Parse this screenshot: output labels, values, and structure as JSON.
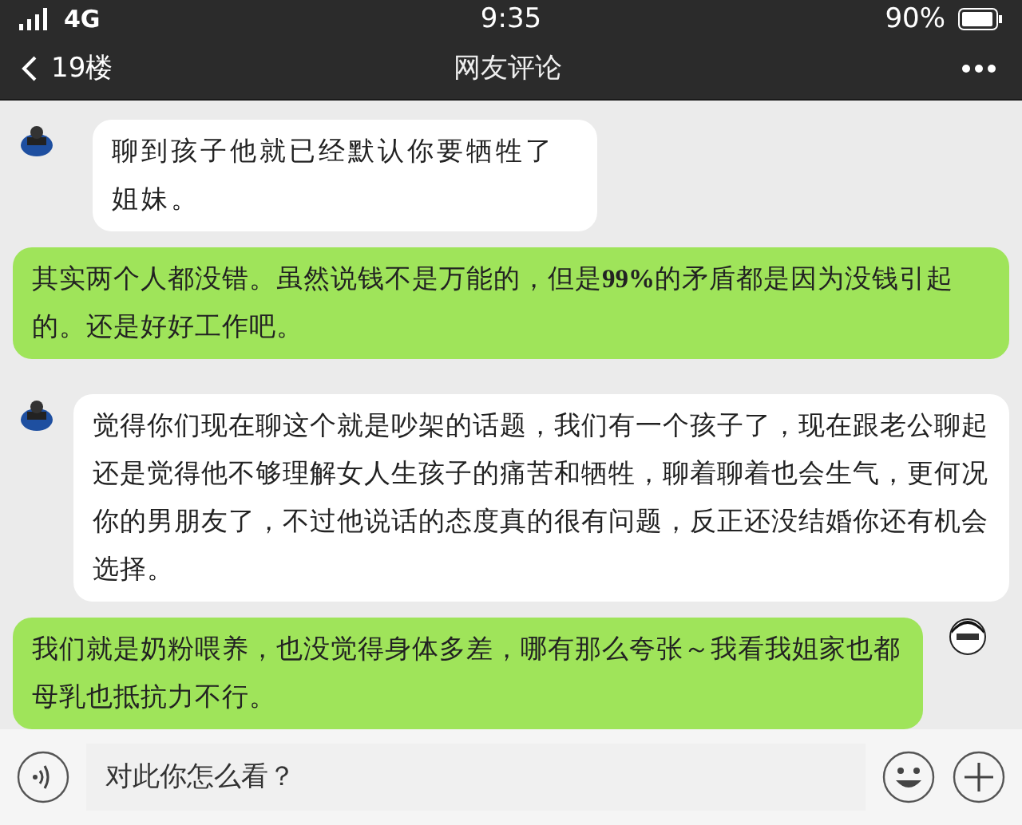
{
  "status_bar": {
    "carrier": "4G",
    "time": "9:35",
    "battery": "90%"
  },
  "nav": {
    "back_label": "19楼",
    "title": "网友评论"
  },
  "messages": [
    {
      "kind": "received",
      "avatar": true,
      "text": "聊到孩子他就已经默认你要牺牲了姐妹。"
    },
    {
      "kind": "sent",
      "avatar": false,
      "text": "其实两个人都没错。虽然说钱不是万能的，但是**99%**的矛盾都是因为没钱引起的。还是好好工作吧。"
    },
    {
      "kind": "received",
      "avatar": true,
      "text": "觉得你们现在聊这个就是吵架的话题，我们有一个孩子了，现在跟老公聊起还是觉得他不够理解女人生孩子的痛苦和牺牲，聊着聊着也会生气，更何况你的男朋友了，不过他说话的态度真的很有问题，反正还没结婚你还有机会选择。"
    },
    {
      "kind": "sent",
      "avatar": true,
      "text": "我们就是奶粉喂养，也没觉得身体多差，哪有那么夸张～我看我姐家也都母乳也抵抗力不行。"
    }
  ],
  "input": {
    "placeholder": "对此你怎么看？"
  }
}
